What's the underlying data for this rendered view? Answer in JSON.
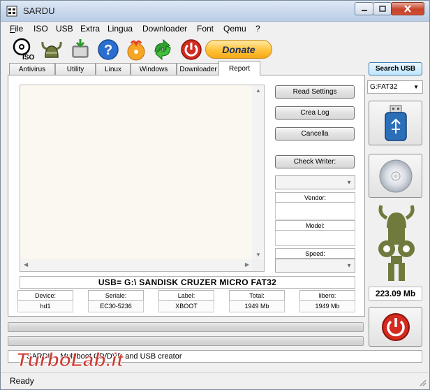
{
  "window": {
    "title": "SARDU"
  },
  "menu": [
    {
      "label": "File",
      "u": "F",
      "rest": "ile"
    },
    {
      "label": "ISO",
      "u": "",
      "rest": "ISO"
    },
    {
      "label": "USB",
      "u": "",
      "rest": "USB"
    },
    {
      "label": "Extra",
      "u": "",
      "rest": "Extra"
    },
    {
      "label": "Lingua",
      "u": "",
      "rest": "Lingua"
    },
    {
      "label": "Downloader",
      "u": "",
      "rest": "Downloader"
    },
    {
      "label": "Font",
      "u": "",
      "rest": "Font"
    },
    {
      "label": "Qemu",
      "u": "",
      "rest": "Qemu"
    },
    {
      "label": "?",
      "u": "",
      "rest": "?"
    }
  ],
  "toolbar": {
    "iso_label": "ISO",
    "donate_label": "Donate"
  },
  "tabs": [
    "Antivirus",
    "Utility",
    "Linux",
    "Windows",
    "Downloader",
    "Report"
  ],
  "report": {
    "buttons": [
      "Read Settings",
      "Crea Log",
      "Cancella",
      "Check Writer:"
    ],
    "fields": [
      "Vendor:",
      "Model:",
      "Speed:"
    ],
    "device_line": "USB= G:\\ SANDISK CRUZER MICRO FAT32",
    "info": [
      {
        "label": "Device:",
        "value": "hd1"
      },
      {
        "label": "Seriale:",
        "value": "EC30-5236"
      },
      {
        "label": "Label:",
        "value": "XBOOT"
      },
      {
        "label": "Total:",
        "value": "1949 Mb"
      },
      {
        "label": "libero:",
        "value": "1949 Mb"
      }
    ]
  },
  "right_panel": {
    "search_label": "Search USB",
    "drive": "G:FAT32",
    "size": "223.09 Mb"
  },
  "status_line": "SARDU - Multiboot CD/DVD and USB creator",
  "watermark": "TurboLab.it",
  "statusbar": {
    "text": "Ready"
  },
  "colors": {
    "accent": "#3c7fb1",
    "power_red": "#d42a1f",
    "donate": "#ffc33a"
  }
}
